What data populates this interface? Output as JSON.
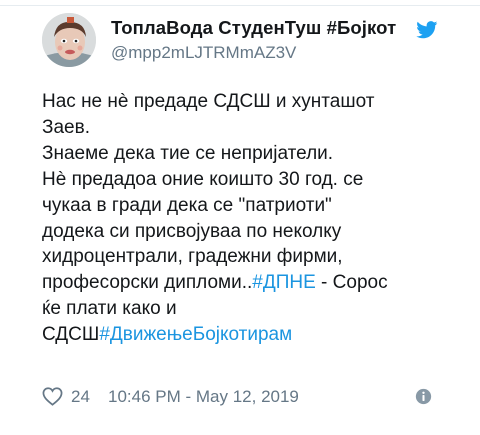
{
  "tweet": {
    "author": {
      "display_name": "ТоплаВода СтуденТуш #Бојкот",
      "handle": "@mpp2mLJTRMmAZ3V",
      "avatar_icon": "user-avatar"
    },
    "brand_icon": "twitter-bird-icon",
    "brand_color": "#1da1f2",
    "link_color": "#1b95e0",
    "text": {
      "line1": "Нас не нè предаде СДСШ и хунташот",
      "line2": "Заев.",
      "line3": "Знаеме дека тие се непријатели.",
      "line4": "Нè предадоа оние коишто 30 год. се",
      "line5": "чукаа в гради дека се \"патриоти\"",
      "line6": "додека си присвојуваа по неколку",
      "line7": "хидроцентрали, градежни фирми,",
      "line8_prefix": "професорски дипломи..",
      "line8_hashtag": "#ДПНЕ",
      "line8_suffix": " - Сорос",
      "line9": "ќе плати како и",
      "line10_prefix": "СДСШ",
      "line10_hashtag": "#ДвижењеБојкотирам"
    },
    "footer": {
      "like_icon": "heart-icon",
      "likes": "24",
      "timestamp": "10:46 PM - May 12, 2019",
      "info_icon": "info-icon"
    }
  }
}
